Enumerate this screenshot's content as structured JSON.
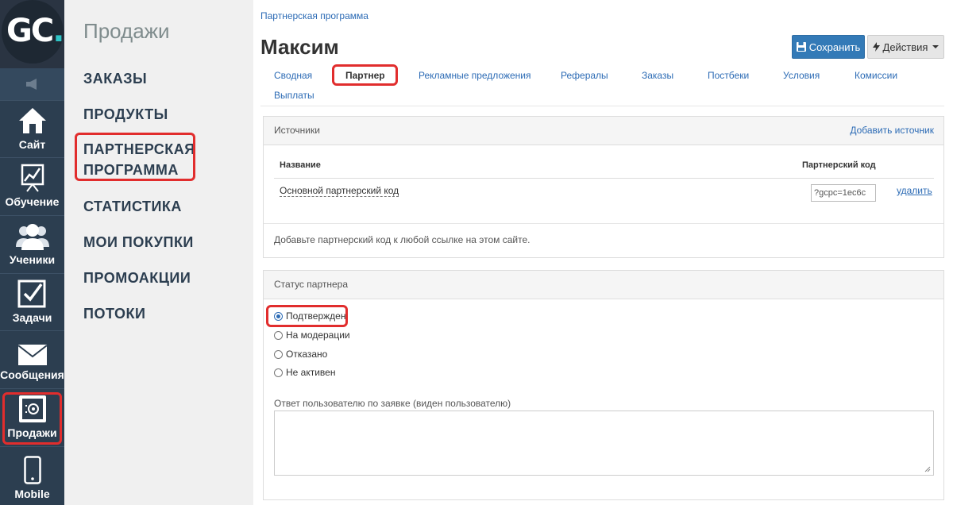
{
  "logo": {
    "text": "GC",
    "dot": "."
  },
  "rail": {
    "items": [
      {
        "label": "Сайт",
        "icon": "home-icon"
      },
      {
        "label": "Обучение",
        "icon": "chart-board-icon"
      },
      {
        "label": "Ученики",
        "icon": "users-icon"
      },
      {
        "label": "Задачи",
        "icon": "checkbox-icon"
      },
      {
        "label": "Сообщения",
        "icon": "envelope-icon"
      },
      {
        "label": "Продажи",
        "icon": "safe-icon"
      },
      {
        "label": "Mobile",
        "icon": "phone-icon"
      }
    ]
  },
  "menu": {
    "title": "Продажи",
    "items": [
      "ЗАКАЗЫ",
      "ПРОДУКТЫ",
      "ПАРТНЕРСКАЯ",
      "ПРОГРАММА",
      "СТАТИСТИКА",
      "МОИ ПОКУПКИ",
      "ПРОМОАКЦИИ",
      "ПОТОКИ"
    ]
  },
  "main": {
    "breadcrumb": "Партнерская программа",
    "title": "Максим",
    "save_label": "Сохранить",
    "actions_label": "Действия",
    "tabs": [
      "Сводная",
      "Партнер",
      "Рекламные предложения",
      "Рефералы",
      "Заказы",
      "Постбеки",
      "Условия",
      "Комиссии",
      "Выплаты"
    ],
    "sources": {
      "title": "Источники",
      "add_link": "Добавить источник",
      "col_name": "Название",
      "col_code": "Партнерский код",
      "row_name": "Основной партнерский код",
      "row_code": "?gcpc=1ec6c",
      "row_delete": "удалить",
      "hint": "Добавьте партнерский код к любой ссылке на этом сайте."
    },
    "status": {
      "title": "Статус партнера",
      "options": [
        "Подтвержден",
        "На модерации",
        "Отказано",
        "Не активен"
      ],
      "response_label": "Ответ пользователю по заявке (виден пользователю)"
    }
  },
  "colors": {
    "rail_bg": "#2c3e50",
    "highlight": "#e12d2d",
    "link": "#2c6bb5",
    "save_btn": "#337ab7"
  }
}
